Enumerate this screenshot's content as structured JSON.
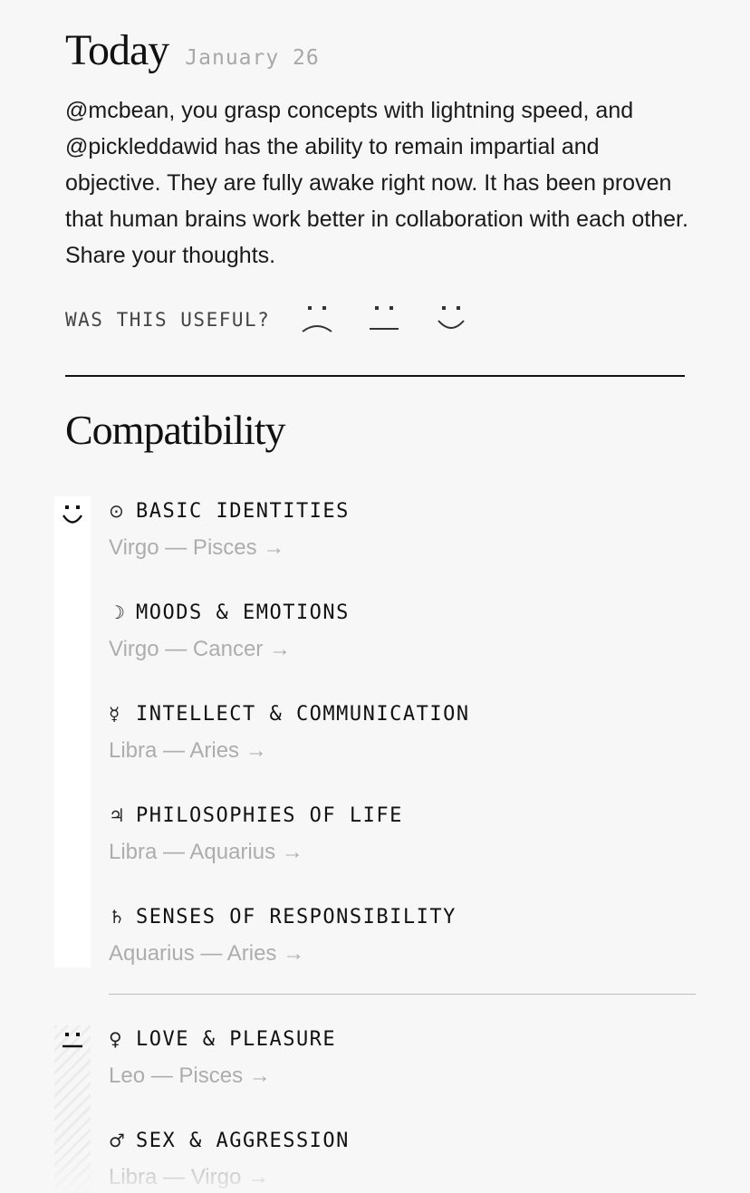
{
  "today": {
    "title": "Today",
    "date": "January 26",
    "text": "@mcbean, you grasp concepts with lightning speed, and @pickleddawid has the ability to remain impartial and objective. They are fully awake right now. It has been proven that human brains work better in collaboration with each other. Share your thoughts.",
    "feedback_label": "WAS THIS USEFUL?",
    "feedback_options": [
      "sad-face-icon",
      "neutral-face-icon",
      "happy-face-icon"
    ]
  },
  "compatibility": {
    "title": "Compatibility",
    "groups": [
      {
        "rating_icon": "happy-face-icon",
        "aspects": [
          {
            "glyph": "⊙",
            "glyph_icon": "sun-icon",
            "label": "BASIC IDENTITIES",
            "signs": "Virgo — Pisces →"
          },
          {
            "glyph": "☽",
            "glyph_icon": "moon-icon",
            "label": "MOODS & EMOTIONS",
            "signs": "Virgo — Cancer →"
          },
          {
            "glyph": "☿",
            "glyph_icon": "mercury-icon",
            "label": "INTELLECT & COMMUNICATION",
            "signs": "Libra — Aries →"
          },
          {
            "glyph": "♃",
            "glyph_icon": "jupiter-icon",
            "label": "PHILOSOPHIES OF LIFE",
            "signs": "Libra — Aquarius →"
          },
          {
            "glyph": "♄",
            "glyph_icon": "saturn-icon",
            "label": "SENSES OF RESPONSIBILITY",
            "signs": "Aquarius — Aries →"
          }
        ]
      },
      {
        "rating_icon": "neutral-face-icon",
        "aspects": [
          {
            "glyph": "♀",
            "glyph_icon": "venus-icon",
            "label": "LOVE & PLEASURE",
            "signs": "Leo — Pisces →"
          },
          {
            "glyph": "♂",
            "glyph_icon": "mars-icon",
            "label": "SEX & AGGRESSION",
            "signs": "Libra — Virgo →"
          }
        ]
      }
    ]
  },
  "colors": {
    "background": "#f7f7f7",
    "text": "#111111",
    "muted": "#adadad"
  }
}
